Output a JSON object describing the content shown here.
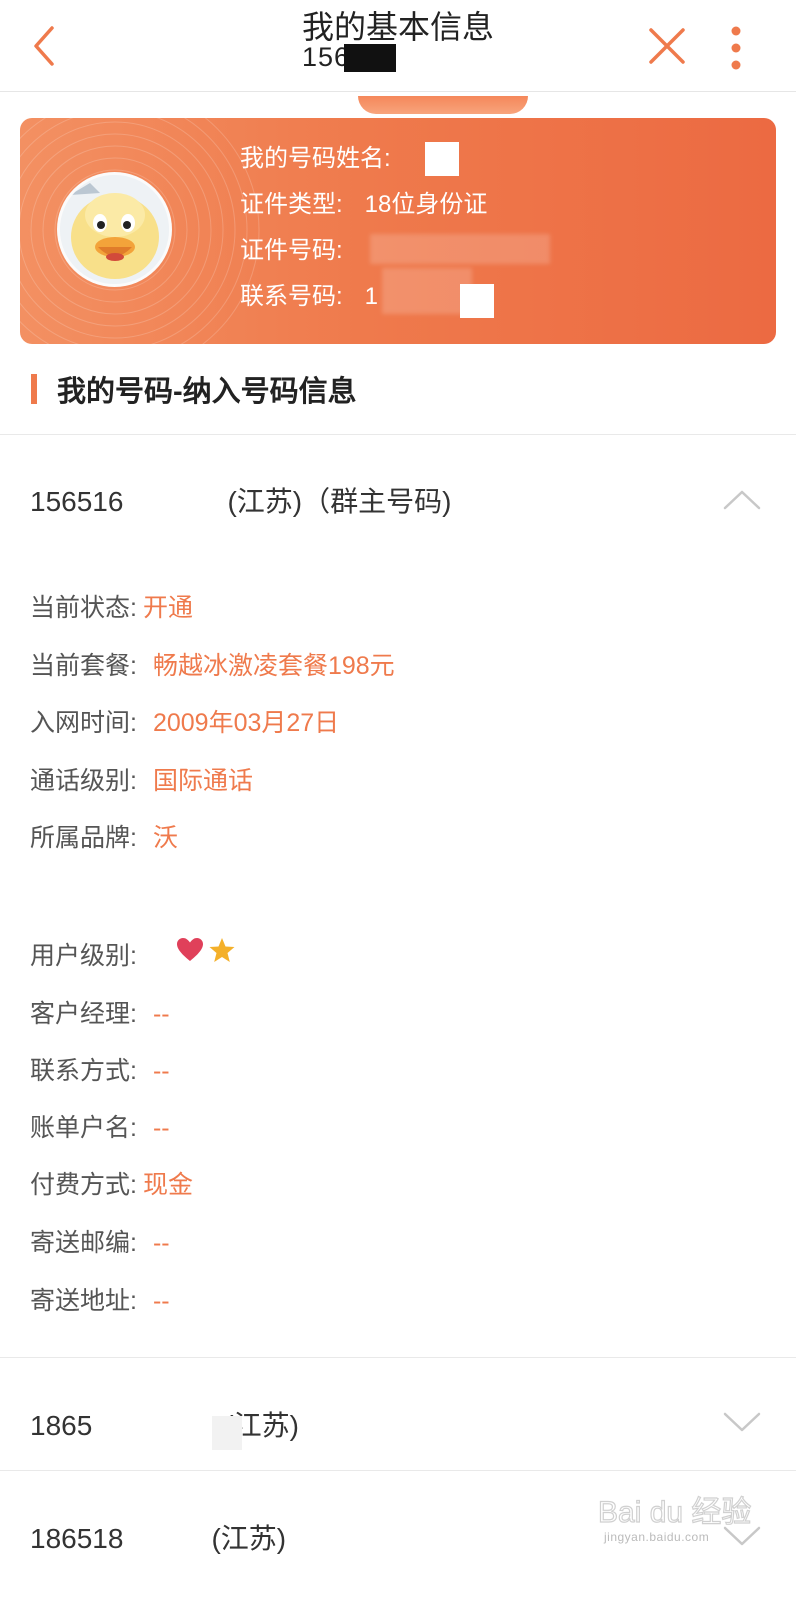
{
  "header": {
    "title": "我的基本信息",
    "subtitle": "1565"
  },
  "card": {
    "rows": [
      {
        "label": "我的号码姓名:",
        "value": ""
      },
      {
        "label": "证件类型:",
        "value": "18位身份证"
      },
      {
        "label": "证件号码:",
        "value": ""
      },
      {
        "label": "联系号码:",
        "value": "1"
      }
    ]
  },
  "section": {
    "title": "我的号码-纳入号码信息"
  },
  "accounts": [
    {
      "prefix": "156516",
      "suffix": "(江苏)（群主号码)",
      "expanded": true
    },
    {
      "prefix": "1865",
      "suffix": "(江苏)",
      "expanded": false
    },
    {
      "prefix": "186518",
      "suffix": "(江苏)",
      "expanded": false
    }
  ],
  "details": {
    "status": {
      "label": "当前状态:",
      "value": "开通"
    },
    "plan": {
      "label": "当前套餐:",
      "value": "畅越冰激凌套餐198元"
    },
    "join_date": {
      "label": "入网时间:",
      "value": "2009年03月27日"
    },
    "call_level": {
      "label": "通话级别:",
      "value": "国际通话"
    },
    "brand": {
      "label": "所属品牌:",
      "value": "沃"
    },
    "user_level": {
      "label": "用户级别:",
      "icons": [
        "heart-icon",
        "star-icon"
      ]
    },
    "manager": {
      "label": "客户经理:",
      "value": "--"
    },
    "contact": {
      "label": "联系方式:",
      "value": "--"
    },
    "bill_name": {
      "label": "账单户名:",
      "value": "--"
    },
    "payment": {
      "label": "付费方式:",
      "value": "现金"
    },
    "postcode": {
      "label": "寄送邮编:",
      "value": "--"
    },
    "address": {
      "label": "寄送地址:",
      "value": "--"
    }
  },
  "watermark": {
    "logo": "Bai du 经验",
    "url": "jingyan.baidu.com"
  },
  "colors": {
    "accent": "#ef7a4c",
    "card_start": "#f39062",
    "card_end": "#ec6a42",
    "heart": "#e0405a",
    "star": "#f4b02a"
  }
}
